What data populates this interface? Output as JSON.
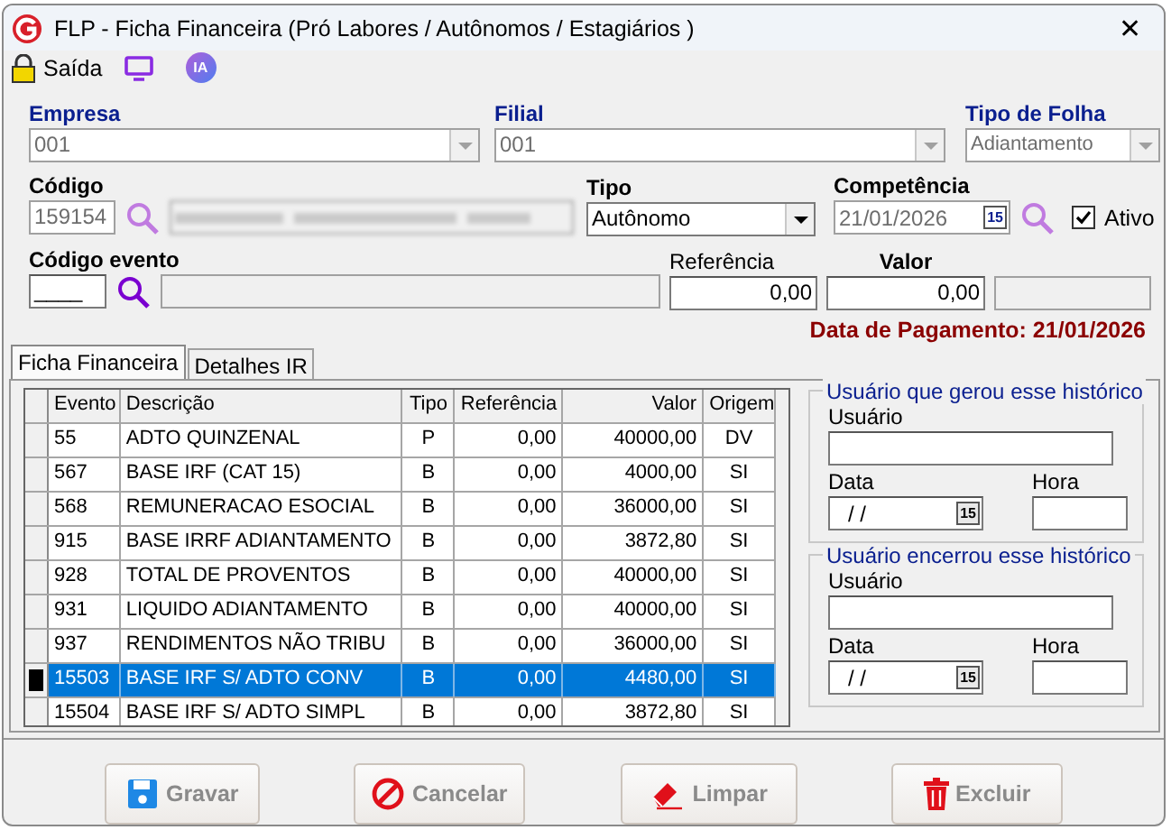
{
  "window": {
    "title": "FLP - Ficha Financeira (Pró Labores / Autônomos / Estagiários )",
    "close": "✕"
  },
  "toolbar": [
    {
      "kind": "lock",
      "label": "Saída"
    },
    {
      "kind": "monitor"
    },
    {
      "kind": "ai",
      "label": "IA"
    }
  ],
  "empresa": {
    "label": "Empresa",
    "value": "001"
  },
  "filial": {
    "label": "Filial",
    "value": "001"
  },
  "tipo_folha": {
    "label": "Tipo de Folha",
    "value": "Adiantamento"
  },
  "codigo": {
    "label": "Código",
    "value": "159154"
  },
  "tipo": {
    "label": "Tipo",
    "value": "Autônomo"
  },
  "competencia": {
    "label": "Competência",
    "value": "21/01/2026",
    "calendar": "15"
  },
  "ativo": {
    "label": "Ativo",
    "checked": true
  },
  "codigo_evento": {
    "label": "Código evento",
    "value": "____"
  },
  "referencia": {
    "label": "Referência",
    "value": "0,00"
  },
  "valor": {
    "label": "Valor",
    "value": "0,00"
  },
  "data_pagamento": "Data de Pagamento: 21/01/2026",
  "tabs": [
    {
      "label": "Ficha Financeira",
      "selected": true
    },
    {
      "label": "Detalhes IR",
      "selected": false
    }
  ],
  "table": {
    "columns": [
      "Evento",
      "Descrição",
      "Tipo",
      "Referência",
      "Valor",
      "Origem"
    ],
    "rows": [
      {
        "cells": [
          "55",
          "ADTO QUINZENAL",
          "P",
          "0,00",
          "40000,00",
          "DV"
        ],
        "selected": false
      },
      {
        "cells": [
          "567",
          "BASE IRF (CAT 15)",
          "B",
          "0,00",
          "4000,00",
          "SI"
        ],
        "selected": false
      },
      {
        "cells": [
          "568",
          "REMUNERACAO ESOCIAL",
          "B",
          "0,00",
          "36000,00",
          "SI"
        ],
        "selected": false
      },
      {
        "cells": [
          "915",
          "BASE IRRF ADIANTAMENTO",
          "B",
          "0,00",
          "3872,80",
          "SI"
        ],
        "selected": false
      },
      {
        "cells": [
          "928",
          "TOTAL DE PROVENTOS",
          "B",
          "0,00",
          "40000,00",
          "SI"
        ],
        "selected": false
      },
      {
        "cells": [
          "931",
          "LIQUIDO ADIANTAMENTO",
          "B",
          "0,00",
          "40000,00",
          "SI"
        ],
        "selected": false
      },
      {
        "cells": [
          "937",
          "RENDIMENTOS NÃO TRIBU",
          "B",
          "0,00",
          "36000,00",
          "SI"
        ],
        "selected": false
      },
      {
        "cells": [
          "15503",
          "BASE IRF S/ ADTO CONV",
          "B",
          "0,00",
          "4480,00",
          "SI"
        ],
        "selected": true
      },
      {
        "cells": [
          "15504",
          "BASE IRF S/ ADTO SIMPL",
          "B",
          "0,00",
          "3872,80",
          "SI"
        ],
        "selected": false
      }
    ]
  },
  "groups": [
    {
      "title": "Usuário que gerou esse histórico",
      "usuario": "Usuário",
      "data": "Data",
      "date_value": "/ /",
      "calendar": "15",
      "hora": "Hora"
    },
    {
      "title": "Usuário encerrou esse histórico",
      "usuario": "Usuário",
      "data": "Data",
      "date_value": "/ /",
      "calendar": "15",
      "hora": "Hora"
    }
  ],
  "buttons": [
    {
      "kind": "save",
      "label": "Gravar"
    },
    {
      "kind": "cancel",
      "label": "Cancelar"
    },
    {
      "kind": "clear",
      "label": "Limpar"
    },
    {
      "kind": "delete",
      "label": "Excluir"
    }
  ]
}
